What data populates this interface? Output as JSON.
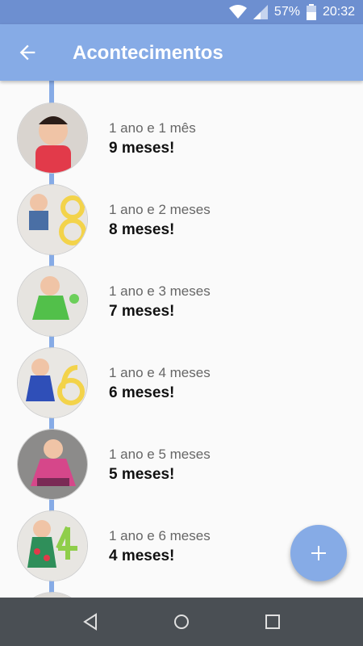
{
  "status_bar": {
    "battery": "57%",
    "time": "20:32"
  },
  "app_bar": {
    "title": "Acontecimentos",
    "back_icon": "arrow-left-icon"
  },
  "colors": {
    "accent": "#86abe6",
    "status": "#6d8fd0",
    "nav": "#4a4f54"
  },
  "events": [
    {
      "age": "1 ano e 1 mês",
      "label": "9 meses!"
    },
    {
      "age": "1 ano e 2 meses",
      "label": "8 meses!"
    },
    {
      "age": "1 ano e 3 meses",
      "label": "7 meses!"
    },
    {
      "age": "1 ano e 4 meses",
      "label": "6 meses!"
    },
    {
      "age": "1 ano e 5 meses",
      "label": "5 meses!"
    },
    {
      "age": "1 ano e 6 meses",
      "label": "4 meses!"
    }
  ],
  "fab": {
    "icon": "plus-icon"
  },
  "nav_bar": {
    "back": "triangle-back-icon",
    "home": "circle-home-icon",
    "recents": "square-recents-icon"
  }
}
